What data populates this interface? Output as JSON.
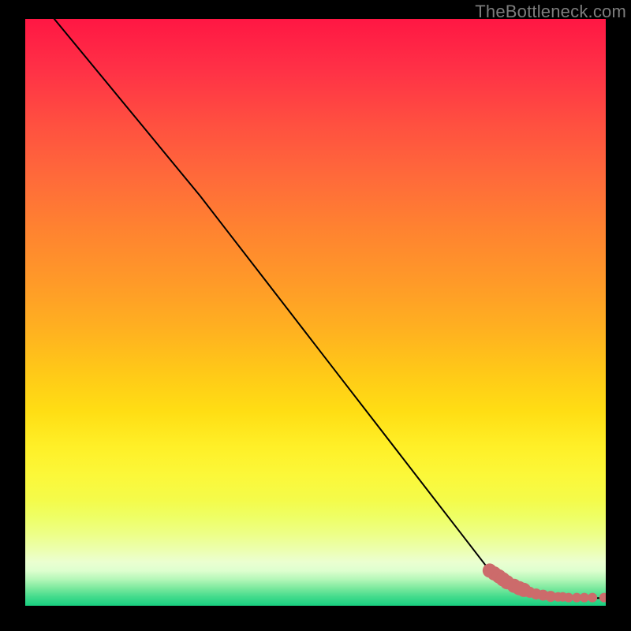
{
  "watermark": "TheBottleneck.com",
  "colors": {
    "curve_stroke": "#000000",
    "marker_fill": "#cc6b6b",
    "marker_stroke": "#b85a5a",
    "frame_bg": "#000000"
  },
  "chart_data": {
    "type": "line",
    "title": "",
    "xlabel": "",
    "ylabel": "",
    "xlim": [
      0,
      100
    ],
    "ylim": [
      0,
      100
    ],
    "note": "Axes have no visible tick labels; values are normalized to 0–100 by reading the curve position against the plot-area extents.",
    "series": [
      {
        "name": "curve",
        "x": [
          5,
          10,
          15,
          20,
          25,
          30,
          35,
          40,
          45,
          50,
          55,
          60,
          65,
          70,
          75,
          80,
          81,
          82,
          83,
          84,
          85,
          86,
          87,
          88,
          89,
          90,
          91,
          92,
          93,
          94,
          95,
          96,
          97,
          98,
          99,
          100
        ],
        "y": [
          100,
          94,
          88,
          82,
          76,
          70,
          63.6,
          57.2,
          50.8,
          44.4,
          38,
          31.6,
          25.2,
          18.8,
          12.4,
          6,
          5.4,
          4.8,
          4.2,
          3.6,
          3.1,
          2.7,
          2.3,
          2.0,
          1.8,
          1.6,
          1.5,
          1.4,
          1.4,
          1.3,
          1.3,
          1.3,
          1.3,
          1.3,
          1.3,
          1.3
        ]
      }
    ],
    "markers": {
      "name": "points",
      "x": [
        80.0,
        80.8,
        81.6,
        82.3,
        83.0,
        84.2,
        85.1,
        85.9,
        86.9,
        88.0,
        89.2,
        90.5,
        91.8,
        92.6,
        93.6,
        95.0,
        96.3,
        97.7,
        99.7
      ],
      "y": [
        6.0,
        5.5,
        5.0,
        4.5,
        4.0,
        3.4,
        3.0,
        2.7,
        2.3,
        2.0,
        1.8,
        1.6,
        1.5,
        1.5,
        1.4,
        1.4,
        1.4,
        1.4,
        1.4
      ],
      "size": [
        9,
        9,
        9,
        9,
        9,
        9,
        9,
        9,
        7,
        7,
        7,
        7,
        6,
        6,
        6,
        6,
        6,
        6,
        6
      ]
    }
  }
}
